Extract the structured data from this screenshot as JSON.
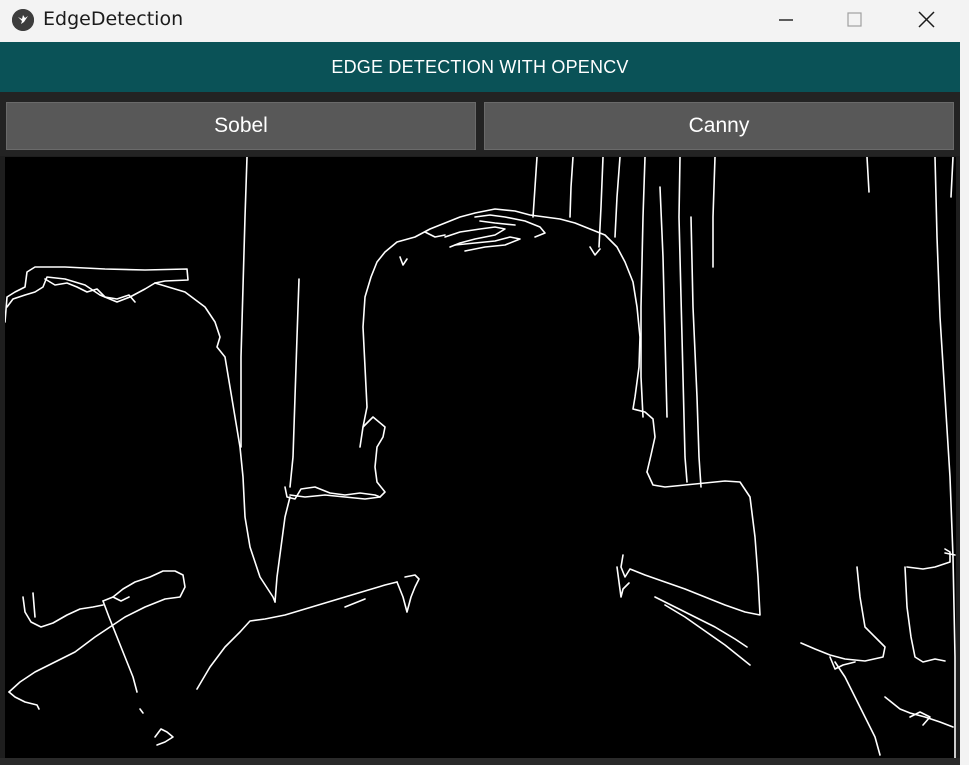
{
  "window": {
    "title": "EdgeDetection",
    "icon": "kivy-app-icon",
    "controls": [
      "minimize-icon",
      "maximize-icon",
      "close-icon"
    ]
  },
  "banner": {
    "text": "EDGE DETECTION WITH OPENCV",
    "color": "#0a5257"
  },
  "buttons": {
    "sobel_label": "Sobel",
    "canny_label": "Canny"
  },
  "canvas": {
    "description_icon": "edge-detection-output",
    "background": "#000000",
    "stroke": "#ffffff"
  }
}
